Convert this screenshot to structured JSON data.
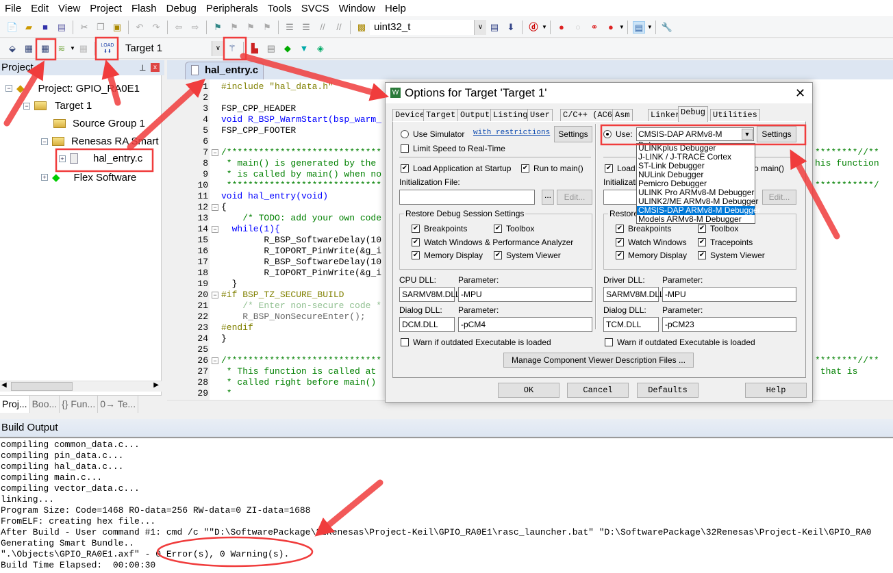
{
  "menu": [
    "File",
    "Edit",
    "View",
    "Project",
    "Flash",
    "Debug",
    "Peripherals",
    "Tools",
    "SVCS",
    "Window",
    "Help"
  ],
  "toolbar1": {
    "find_value": "uint32_t",
    "icons": [
      "new-file",
      "open",
      "save",
      "save-all",
      "cut",
      "copy",
      "paste",
      "undo",
      "redo",
      "back",
      "forward",
      "bookmark",
      "prev-bookmark",
      "next-bookmark",
      "clear-bookmarks",
      "indent",
      "unindent",
      "comment",
      "uncomment",
      "find-in-files",
      "find-combo",
      "debug-session",
      "breakpoint",
      "disable-breakpoint",
      "kill-breakpoints",
      "kill-all",
      "window-layout",
      "configure"
    ]
  },
  "toolbar2": {
    "target": "Target 1",
    "load_label": "LOAD",
    "icons": [
      "translate",
      "build",
      "rebuild",
      "batch-build",
      "stop-build",
      "download",
      "target-options",
      "manage-rte",
      "file-extensions",
      "select-packs",
      "pack-installer",
      "manage-run-time"
    ]
  },
  "project": {
    "title": "Project",
    "tree": [
      "Project: GPIO_RA0E1",
      "Target 1",
      "Source Group 1",
      "Renesas RA Smart",
      "hal_entry.c",
      "Flex Software"
    ],
    "tabs": [
      "Proj...",
      "Boo...",
      "{} Fun...",
      "0→ Te..."
    ]
  },
  "editor": {
    "tab": "hal_entry.c",
    "lines": [
      {
        "n": "1",
        "t": "#include \"hal_data.h\"",
        "c": "pp"
      },
      {
        "n": "2",
        "t": ""
      },
      {
        "n": "3",
        "t": "FSP_CPP_HEADER"
      },
      {
        "n": "4",
        "t": "void R_BSP_WarmStart(bsp_warm_",
        "c": "kw"
      },
      {
        "n": "5",
        "t": "FSP_CPP_FOOTER"
      },
      {
        "n": "6",
        "t": ""
      },
      {
        "n": "7",
        "t": "/*****************************",
        "c": "cm",
        "tail": "********//**"
      },
      {
        "n": "8",
        "t": " * main() is generated by the",
        "c": "cm",
        "tail": "his function"
      },
      {
        "n": "9",
        "t": " * is called by main() when no",
        "c": "cm"
      },
      {
        "n": "10",
        "t": " *****************************",
        "c": "cm",
        "tail": "***********/"
      },
      {
        "n": "11",
        "t": "void hal_entry(void)",
        "c": "kw"
      },
      {
        "n": "12",
        "t": "{"
      },
      {
        "n": "13",
        "t": "    /* TODO: add your own code",
        "c": "cm"
      },
      {
        "n": "14",
        "t": "  while(1){",
        "c": "kw"
      },
      {
        "n": "15",
        "t": "        R_BSP_SoftwareDelay(10"
      },
      {
        "n": "16",
        "t": "        R_IOPORT_PinWrite(&g_i"
      },
      {
        "n": "17",
        "t": "        R_BSP_SoftwareDelay(10"
      },
      {
        "n": "18",
        "t": "        R_IOPORT_PinWrite(&g_i"
      },
      {
        "n": "19",
        "t": "  }"
      },
      {
        "n": "20",
        "t": "#if BSP_TZ_SECURE_BUILD",
        "c": "pp"
      },
      {
        "n": "21",
        "t": "    /* Enter non-secure code *",
        "c": "cmg"
      },
      {
        "n": "22",
        "t": "    R_BSP_NonSecureEnter();",
        "c": "gr"
      },
      {
        "n": "23",
        "t": "#endif",
        "c": "pp"
      },
      {
        "n": "24",
        "t": "}"
      },
      {
        "n": "25",
        "t": ""
      },
      {
        "n": "26",
        "t": "/*****************************",
        "c": "cm",
        "tail": "********//**"
      },
      {
        "n": "27",
        "t": " * This function is called at",
        "c": "cm",
        "tail": " that is"
      },
      {
        "n": "28",
        "t": " * called right before main()",
        "c": "cm"
      },
      {
        "n": "29",
        "t": " *",
        "c": "cm"
      }
    ]
  },
  "dialog": {
    "title": "Options for Target 'Target 1'",
    "tabs": [
      "Device",
      "Target",
      "Output",
      "Listing",
      "User",
      "C/C++ (AC6)",
      "Asm",
      "Linker",
      "Debug",
      "Utilities"
    ],
    "active_tab": "Debug",
    "left": {
      "use_simulator": "Use Simulator",
      "restrictions_link": "with restrictions",
      "settings": "Settings",
      "limit_speed": "Limit Speed to Real-Time",
      "load_app": "Load Application at Startup",
      "run_to_main": "Run to main()",
      "init_file": "Initialization File:",
      "browse": "...",
      "edit": "Edit...",
      "restore_group": "Restore Debug Session Settings",
      "restore": [
        "Breakpoints",
        "Toolbox",
        "Watch Windows & Performance Analyzer",
        "Memory Display",
        "System Viewer"
      ],
      "cpu_dll_label": "CPU DLL:",
      "param_label": "Parameter:",
      "cpu_dll": "SARMV8M.DLL",
      "cpu_param": "-MPU",
      "dialog_dll_label": "Dialog DLL:",
      "dialog_dll": "DCM.DLL",
      "dialog_param": "-pCM4",
      "warn": "Warn if outdated Executable is loaded"
    },
    "right": {
      "use": "Use:",
      "debugger": "CMSIS-DAP ARMv8-M Debugg",
      "settings": "Settings",
      "load": "Load",
      "run_to_main_partial": "o main()",
      "init_partial": "Initializatio",
      "edit": "Edit...",
      "restore_partial": "Restore",
      "restore": [
        "Breakpoints",
        "Toolbox",
        "Watch Windows",
        "Tracepoints",
        "Memory Display",
        "System Viewer"
      ],
      "driver_dll_label": "Driver DLL:",
      "param_label": "Parameter:",
      "driver_dll": "SARMV8M.DLL",
      "driver_param": "-MPU",
      "dialog_dll_label": "Dialog DLL:",
      "dialog_dll": "TCM.DLL",
      "dialog_param": "-pCM23",
      "warn": "Warn if outdated Executable is loaded"
    },
    "debugger_options": [
      "ULINKplus Debugger",
      "J-LINK / J-TRACE Cortex",
      "ST-Link Debugger",
      "NULink Debugger",
      "Pemicro Debugger",
      "ULINK Pro ARMv8-M Debugger",
      "ULINK2/ME ARMv8-M Debugger",
      "CMSIS-DAP ARMv8-M Debugger",
      "Models ARMv8-M Debugger"
    ],
    "selected_debugger": "CMSIS-DAP ARMv8-M Debugger",
    "manage": "Manage Component Viewer Description Files ...",
    "ok": "OK",
    "cancel": "Cancel",
    "defaults": "Defaults",
    "help": "Help"
  },
  "build_output": {
    "title": "Build Output",
    "lines": [
      "compiling common_data.c...",
      "compiling pin_data.c...",
      "compiling hal_data.c...",
      "compiling main.c...",
      "compiling vector_data.c...",
      "linking...",
      "Program Size: Code=1468 RO-data=256 RW-data=0 ZI-data=1688",
      "FromELF: creating hex file...",
      "After Build - User command #1: cmd /c \"\"D:\\SoftwarePackage\\32Renesas\\Project-Keil\\GPIO_RA0E1\\rasc_launcher.bat\" \"D:\\SoftwarePackage\\32Renesas\\Project-Keil\\GPIO_RA0",
      "Generating Smart Bundle..",
      "\".\\Objects\\GPIO_RA0E1.axf\" - 0 Error(s), 0 Warning(s).",
      "Build Time Elapsed:  00:00:30"
    ]
  },
  "colors": {
    "annotation": "#f03c3c",
    "selection": "#0078d7",
    "keyword": "#0000ff",
    "comment": "#008000",
    "preprocessor": "#808000"
  }
}
